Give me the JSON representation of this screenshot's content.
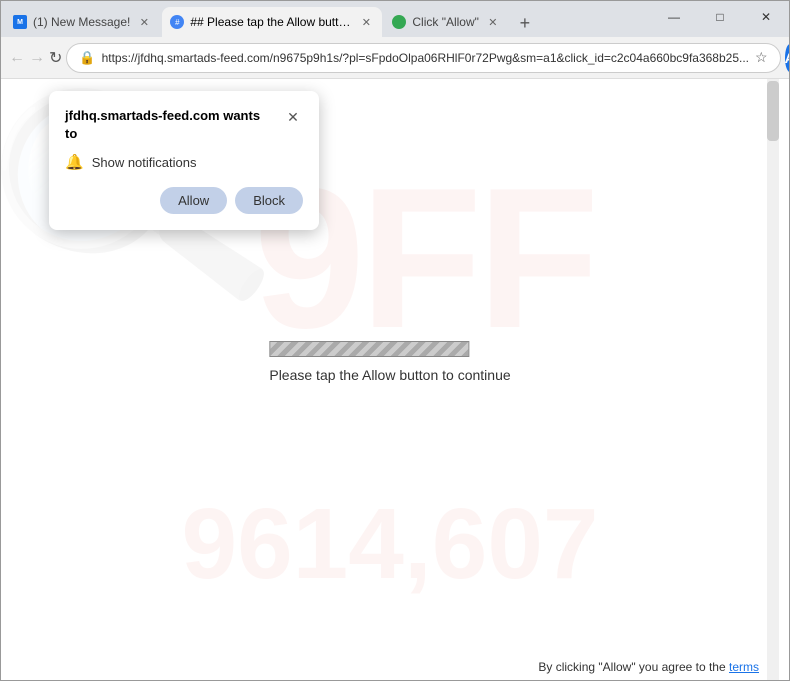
{
  "browser": {
    "tabs": [
      {
        "id": "tab1",
        "title": "(1) New Message!",
        "active": false,
        "favicon_type": "new-message"
      },
      {
        "id": "tab2",
        "title": "## Please tap the Allow button...",
        "active": true,
        "favicon_type": "smartads"
      },
      {
        "id": "tab3",
        "title": "Click \"Allow\"",
        "active": false,
        "favicon_type": "click"
      }
    ],
    "url": "https://jfdhq.smartads-feed.com/n9675p9h1s/?pl=sFpdoOlpa06RHlF0r72Pwg&sm=a1&click_id=c2c04a660bc9fa368b25...",
    "nav_buttons": {
      "back_disabled": true,
      "forward_disabled": true
    }
  },
  "popup": {
    "domain": "jfdhq.smartads-feed.com",
    "wants_to": "wants to",
    "permission_label": "Show notifications",
    "allow_button": "Allow",
    "block_button": "Block"
  },
  "page": {
    "progress_text": "Please tap the Allow button to continue"
  },
  "footer": {
    "text": "By clicking \"Allow\" you agree to the ",
    "link_text": "terms"
  },
  "watermark": {
    "top": "9FF",
    "bottom": "9614,607",
    "magnifier": "🔍"
  },
  "window_controls": {
    "minimize": "—",
    "maximize": "□",
    "close": "✕"
  }
}
